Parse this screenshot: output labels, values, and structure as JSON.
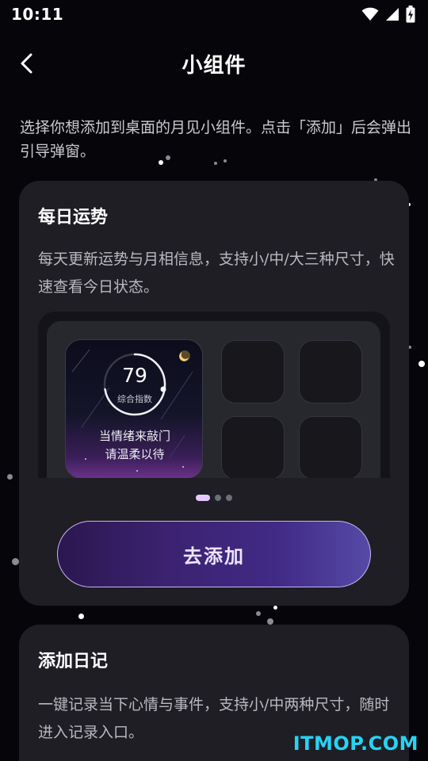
{
  "status": {
    "time": "10:11",
    "icons": [
      "wifi-icon",
      "signal-icon",
      "battery-charging-icon"
    ]
  },
  "header": {
    "back_icon": "chevron-left-icon",
    "title": "小组件"
  },
  "intro": "选择你想添加到桌面的月见小组件。点击「添加」后会弹出引导弹窗。",
  "cards": [
    {
      "title": "每日运势",
      "description": "每天更新运势与月相信息，支持小/中/大三种尺寸，快速查看今日状态。",
      "preview": {
        "score": "79",
        "score_label": "综合指数",
        "line1": "当情绪来敲门",
        "line2": "请温柔以待",
        "moon_icon": "moon-icon"
      },
      "pager": {
        "count": 3,
        "active": 0
      },
      "button_label": "去添加"
    },
    {
      "title": "添加日记",
      "description": "一键记录当下心情与事件，支持小/中两种尺寸，随时进入记录入口。"
    }
  ],
  "watermark": "ITMOP.COM",
  "colors": {
    "background": "#06060a",
    "card": "#1e1e24",
    "accent": "#c9b5f5",
    "pager_active": "#e6c8ff",
    "watermark": "#27d3f5"
  }
}
